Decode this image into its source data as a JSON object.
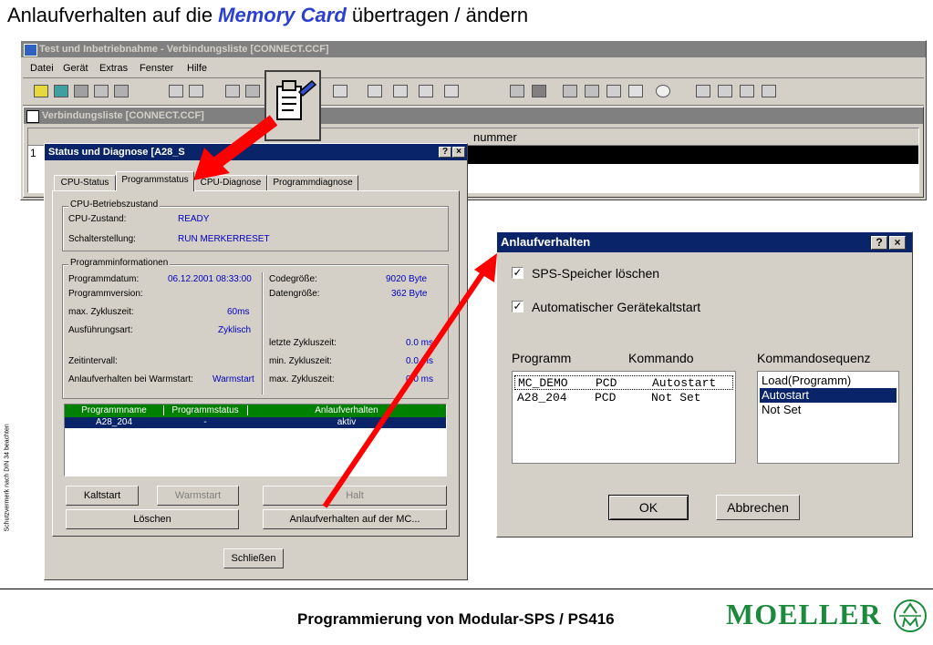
{
  "slide": {
    "title_prefix": "Anlaufverhalten auf die ",
    "title_highlight": "Memory Card",
    "title_suffix": " übertragen / ändern",
    "side_note": "Schutzvermerk nach DIN 34 beachten",
    "footer": "Programmierung von Modular-SPS / PS416",
    "logo_text": "MOELLER",
    "accent_color": "#2b3fd1",
    "arrow_color": "#ff0000"
  },
  "main_window": {
    "title": "Test und Inbetriebnahme - Verbindungsliste [CONNECT.CCF]",
    "menu": [
      "Datei",
      "Gerät",
      "Extras",
      "Fenster",
      "Hilfe"
    ],
    "child_title": "Verbindungsliste [CONNECT.CCF]",
    "column_header": "nummer",
    "row_number": "1"
  },
  "status_dialog": {
    "title": "Status und Diagnose [A28_S",
    "help": "?",
    "close": "×",
    "tabs": [
      "CPU-Status",
      "Programmstatus",
      "CPU-Diagnose",
      "Programmdiagnose"
    ],
    "betrieb": {
      "legend": "CPU-Betriebszustand",
      "cpu_label": "CPU-Zustand:",
      "cpu_value": "READY",
      "switch_label": "Schalterstellung:",
      "switch_value": "RUN MERKERRESET"
    },
    "info": {
      "legend": "Programminformationen",
      "datum_label": "Programmdatum:",
      "datum_value": "06.12.2001 08:33:00",
      "version_label": "Programmversion:",
      "maxzyklus_label": "max. Zykluszeit:",
      "maxzyklus_value": "60ms",
      "art_label": "Ausführungsart:",
      "art_value": "Zyklisch",
      "intervall_label": "Zeitintervall:",
      "anlauf_label": "Anlaufverhalten bei Warmstart:",
      "anlauf_value": "Warmstart",
      "code_label": "Codegröße:",
      "code_value": "9020 Byte",
      "daten_label": "Datengröße:",
      "daten_value": "362 Byte",
      "letzte_label": "letzte Zykluszeit:",
      "letzte_value": "0.0 ms",
      "min_label": "min.  Zykluszeit:",
      "min_value": "0.0 ms",
      "max_label": "max.  Zykluszeit:",
      "max_value": "0.0 ms"
    },
    "table": {
      "headers": [
        "Programmname",
        "Programmstatus",
        "Anlaufverhalten"
      ],
      "row": [
        "A28_204",
        "-",
        "aktiv"
      ]
    },
    "buttons": {
      "kaltstart": "Kaltstart",
      "warmstart": "Warmstart",
      "halt": "Halt",
      "loeschen": "Löschen",
      "anlauf_mc": "Anlaufverhalten auf der MC...",
      "schliessen": "Schließen"
    }
  },
  "anlauf_dialog": {
    "title": "Anlaufverhalten",
    "help": "?",
    "close": "×",
    "check1": "SPS-Speicher löschen",
    "check2": "Automatischer Gerätekaltstart",
    "col_programm": "Programm",
    "col_kommando": "Kommando",
    "col_sequenz": "Kommandosequenz",
    "programs": [
      {
        "name": "MC_DEMO",
        "type": "PCD",
        "cmd": "Autostart"
      },
      {
        "name": "A28_204",
        "type": "PCD",
        "cmd": "Not Set"
      }
    ],
    "sequence": [
      "Load(Programm)",
      "Autostart",
      "Not Set"
    ],
    "ok": "OK",
    "cancel": "Abbrechen"
  }
}
